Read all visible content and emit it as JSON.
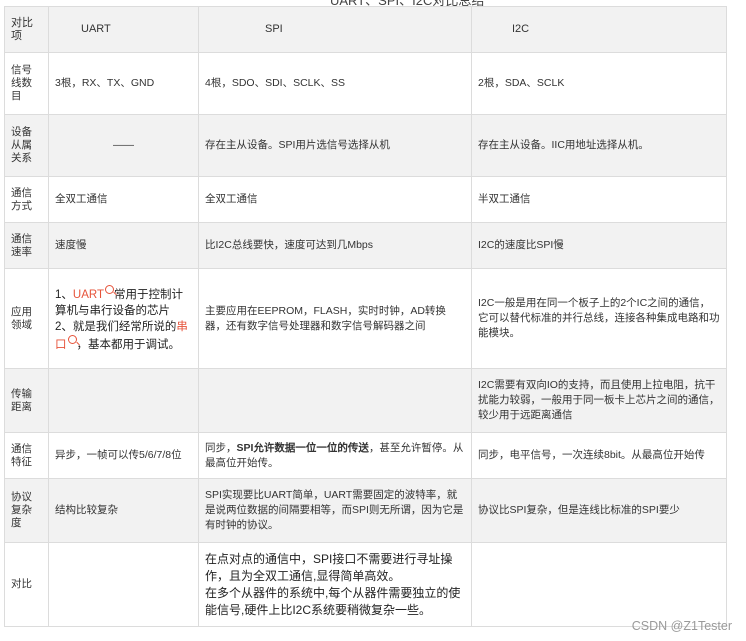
{
  "page_title": "UART、SPI、I2C对比总结",
  "header": {
    "row_label": "对比项",
    "uart": "UART",
    "spi": "SPI",
    "i2c": "I2C"
  },
  "rows": [
    {
      "label": "信号线数目",
      "uart": "3根，RX、TX、GND",
      "spi": "4根，SDO、SDI、SCLK、SS",
      "i2c": "2根，SDA、SCLK"
    },
    {
      "label": "设备从属关系",
      "uart": "——",
      "spi": "存在主从设备。SPI用片选信号选择从机",
      "i2c": "存在主从设备。IIC用地址选择从机。"
    },
    {
      "label": "通信方式",
      "uart": "全双工通信",
      "spi": "全双工通信",
      "i2c": "半双工通信"
    },
    {
      "label": "通信速率",
      "uart": "速度慢",
      "spi": "比I2C总线要快，速度可达到几Mbps",
      "i2c": "I2C的速度比SPI慢"
    },
    {
      "label": "应用领域",
      "uart_line1_pre": "1、",
      "uart_link1": "UART",
      "uart_line1_post": "常用于控制计算机与串行设备的芯片",
      "uart_line2_pre": "2、就是我们经常所说的",
      "uart_link2": "串口",
      "uart_line2_post": "，基本都用于调试。",
      "spi": "主要应用在EEPROM，FLASH，实时时钟，AD转换器，还有数字信号处理器和数字信号解码器之间",
      "i2c": "I2C一般是用在同一个板子上的2个IC之间的通信，它可以替代标准的并行总线，连接各种集成电路和功能模块。"
    },
    {
      "label": "传输距离",
      "uart": "",
      "spi": "",
      "i2c": "I2C需要有双向IO的支持，而且使用上拉电阻，抗干扰能力较弱，一般用于同一板卡上芯片之间的通信，较少用于远距离通信"
    },
    {
      "label": "通信特征",
      "uart": "异步，一帧可以传5/6/7/8位",
      "spi_pre": "同步，",
      "spi_bold": "SPI允许数据一位一位的传送",
      "spi_post": "，甚至允许暂停。从最高位开始传。",
      "i2c": "同步，电平信号，一次连续8bit。从最高位开始传"
    },
    {
      "label": "协议复杂度",
      "uart": "结构比较复杂",
      "spi": "SPI实现要比UART简单，UART需要固定的波特率，就是说两位数据的间隔要相等，而SPI则无所谓，因为它是有时钟的协议。",
      "i2c": "协议比SPI复杂，但是连线比标准的SPI要少"
    },
    {
      "label": "对比",
      "uart": "",
      "spi_p1": "在点对点的通信中，SPI接口不需要进行寻址操作，且为全双工通信,显得简单高效。",
      "spi_p2": "在多个从器件的系统中,每个从器件需要独立的使能信号,硬件上比I2C系统要稍微复杂一些。",
      "i2c": ""
    }
  ],
  "watermark": "CSDN @Z1Tester",
  "colors": {
    "link": "#e6533a",
    "row_shade": "#f2f2f2",
    "border": "#dcdcdc"
  }
}
